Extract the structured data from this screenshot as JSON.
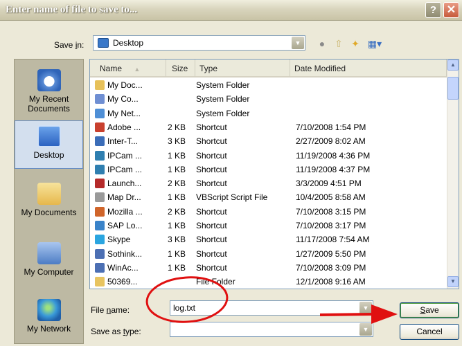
{
  "window": {
    "title": "Enter name of file to save to..."
  },
  "title_buttons": {
    "help": "?",
    "close": "✕"
  },
  "savein": {
    "label_prefix": "Save ",
    "label_u": "i",
    "label_suffix": "n:",
    "value": "Desktop"
  },
  "places": [
    {
      "label": "My Recent Documents",
      "icon": "recent-documents-icon"
    },
    {
      "label": "Desktop",
      "icon": "desktop-icon"
    },
    {
      "label": "My Documents",
      "icon": "my-documents-icon"
    },
    {
      "label": "My Computer",
      "icon": "my-computer-icon"
    },
    {
      "label": "My Network",
      "icon": "my-network-icon"
    }
  ],
  "columns": {
    "name": "Name",
    "size": "Size",
    "type": "Type",
    "modified": "Date Modified"
  },
  "files": [
    {
      "name": "My Doc...",
      "size": "",
      "type": "System Folder",
      "modified": ""
    },
    {
      "name": "My Co...",
      "size": "",
      "type": "System Folder",
      "modified": ""
    },
    {
      "name": "My Net...",
      "size": "",
      "type": "System Folder",
      "modified": ""
    },
    {
      "name": "Adobe ...",
      "size": "2 KB",
      "type": "Shortcut",
      "modified": "7/10/2008 1:54 PM"
    },
    {
      "name": "Inter-T...",
      "size": "3 KB",
      "type": "Shortcut",
      "modified": "2/27/2009 8:02 AM"
    },
    {
      "name": "IPCam ...",
      "size": "1 KB",
      "type": "Shortcut",
      "modified": "11/19/2008 4:36 PM"
    },
    {
      "name": "IPCam ...",
      "size": "1 KB",
      "type": "Shortcut",
      "modified": "11/19/2008 4:37 PM"
    },
    {
      "name": "Launch...",
      "size": "2 KB",
      "type": "Shortcut",
      "modified": "3/3/2009 4:51 PM"
    },
    {
      "name": "Map Dr...",
      "size": "1 KB",
      "type": "VBScript Script File",
      "modified": "10/4/2005 8:58 AM"
    },
    {
      "name": "Mozilla ...",
      "size": "2 KB",
      "type": "Shortcut",
      "modified": "7/10/2008 3:15 PM"
    },
    {
      "name": "SAP Lo...",
      "size": "1 KB",
      "type": "Shortcut",
      "modified": "7/10/2008 3:17 PM"
    },
    {
      "name": "Skype",
      "size": "3 KB",
      "type": "Shortcut",
      "modified": "11/17/2008 7:54 AM"
    },
    {
      "name": "Sothink...",
      "size": "1 KB",
      "type": "Shortcut",
      "modified": "1/27/2009 5:50 PM"
    },
    {
      "name": "WinAc...",
      "size": "1 KB",
      "type": "Shortcut",
      "modified": "7/10/2008 3:09 PM"
    },
    {
      "name": "50369...",
      "size": "",
      "type": "File Folder",
      "modified": "12/1/2008 9:16 AM"
    }
  ],
  "filename": {
    "label_pre": "File ",
    "label_u": "n",
    "label_post": "ame:",
    "value": "log.txt"
  },
  "saveas": {
    "label_pre": "Save as ",
    "label_u": "t",
    "label_post": "ype:",
    "value": ""
  },
  "buttons": {
    "save_u": "S",
    "save_rest": "ave",
    "cancel": "Cancel"
  },
  "colors": {
    "annotation": "#e01010",
    "title_text": "#ffffff"
  }
}
